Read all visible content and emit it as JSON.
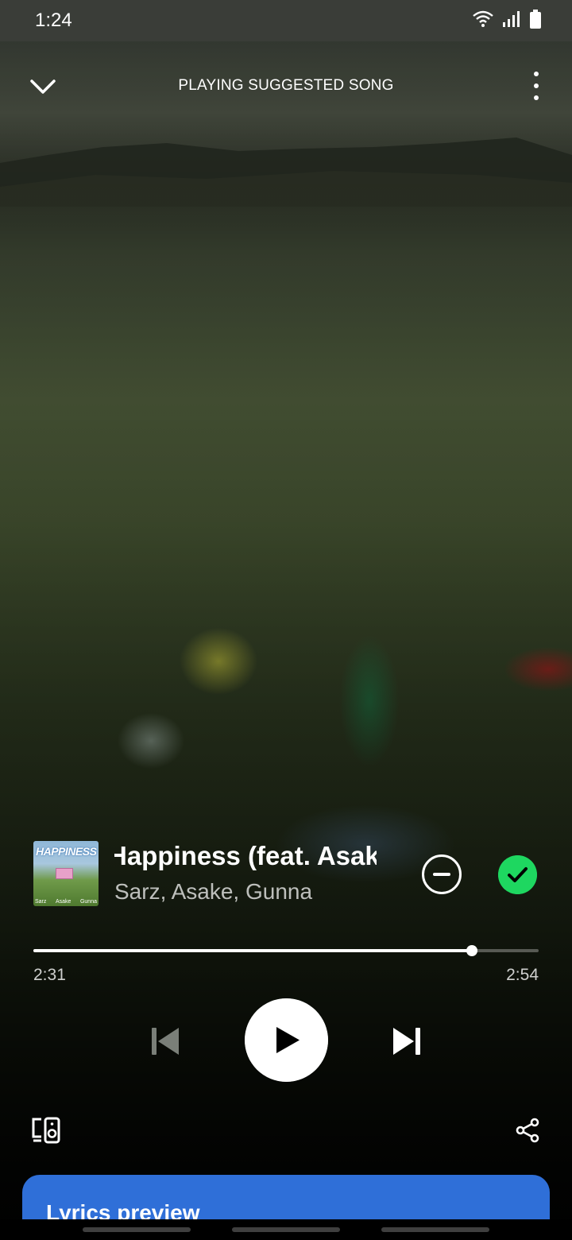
{
  "status_bar": {
    "time": "1:24",
    "icons": [
      "wifi-icon",
      "signal-icon",
      "battery-icon"
    ]
  },
  "header": {
    "context_title": "PLAYING SUGGESTED SONG",
    "collapse_icon": "chevron-down-icon",
    "more_icon": "more-vertical-icon"
  },
  "track": {
    "title": "Happiness (feat. Asake)",
    "artists": "Sarz, Asake, Gunna",
    "cover": {
      "title_text": "HAPPINESS",
      "names": [
        "Sarz",
        "Asake",
        "Gunna"
      ]
    },
    "ban_icon": "minus-circle-icon",
    "added_icon": "check-circle-icon"
  },
  "playback": {
    "elapsed": "2:31",
    "total": "2:54",
    "progress_fraction": 0.868,
    "prev_icon": "skip-previous-icon",
    "play_icon": "play-icon",
    "next_icon": "skip-next-icon"
  },
  "footer": {
    "devices_icon": "connect-devices-icon",
    "share_icon": "share-icon"
  },
  "lyrics": {
    "title": "Lyrics preview"
  },
  "colors": {
    "accent_green": "#1ed760",
    "lyrics_blue": "#2f6fd8"
  }
}
